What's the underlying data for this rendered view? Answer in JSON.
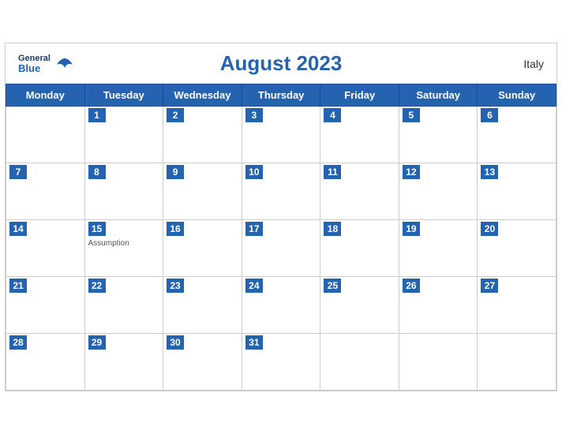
{
  "header": {
    "title": "August 2023",
    "country": "Italy",
    "logo": {
      "general": "General",
      "blue": "Blue"
    }
  },
  "weekdays": [
    "Monday",
    "Tuesday",
    "Wednesday",
    "Thursday",
    "Friday",
    "Saturday",
    "Sunday"
  ],
  "weeks": [
    [
      {
        "day": null
      },
      {
        "day": 1
      },
      {
        "day": 2
      },
      {
        "day": 3
      },
      {
        "day": 4
      },
      {
        "day": 5
      },
      {
        "day": 6
      }
    ],
    [
      {
        "day": 7
      },
      {
        "day": 8
      },
      {
        "day": 9
      },
      {
        "day": 10
      },
      {
        "day": 11
      },
      {
        "day": 12
      },
      {
        "day": 13
      }
    ],
    [
      {
        "day": 14
      },
      {
        "day": 15,
        "event": "Assumption"
      },
      {
        "day": 16
      },
      {
        "day": 17
      },
      {
        "day": 18
      },
      {
        "day": 19
      },
      {
        "day": 20
      }
    ],
    [
      {
        "day": 21
      },
      {
        "day": 22
      },
      {
        "day": 23
      },
      {
        "day": 24
      },
      {
        "day": 25
      },
      {
        "day": 26
      },
      {
        "day": 27
      }
    ],
    [
      {
        "day": 28
      },
      {
        "day": 29
      },
      {
        "day": 30
      },
      {
        "day": 31
      },
      {
        "day": null
      },
      {
        "day": null
      },
      {
        "day": null
      }
    ]
  ],
  "colors": {
    "header_bg": "#2563b0",
    "day_number_bg": "#2563b0",
    "day_number_text": "#ffffff"
  }
}
